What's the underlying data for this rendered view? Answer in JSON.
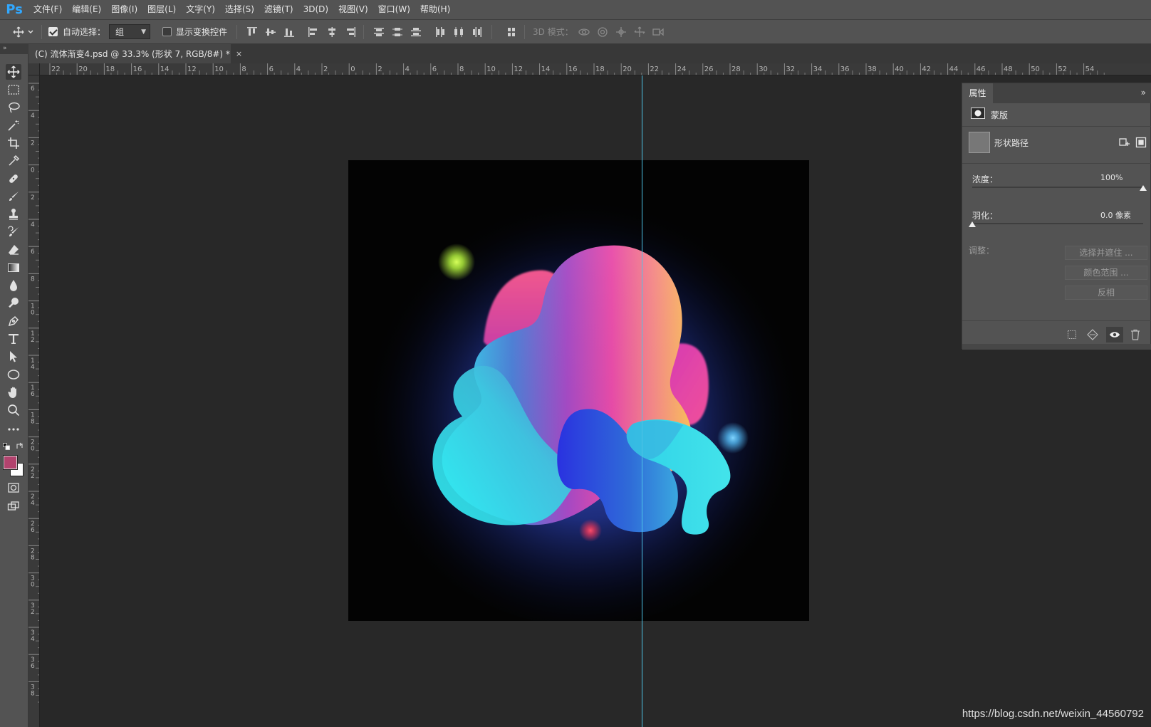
{
  "app": {
    "logo": "Ps"
  },
  "menu": [
    "文件(F)",
    "编辑(E)",
    "图像(I)",
    "图层(L)",
    "文字(Y)",
    "选择(S)",
    "滤镜(T)",
    "3D(D)",
    "视图(V)",
    "窗口(W)",
    "帮助(H)"
  ],
  "options_bar": {
    "auto_select_label": "自动选择：",
    "auto_select_checked": true,
    "auto_select_value": "组",
    "show_transform_label": "显示变换控件",
    "show_transform_checked": false,
    "mode_3d_label": "3D 模式："
  },
  "panel_strip_label": "»",
  "document_tab": {
    "title": "(C) 流体渐变4.psd @ 33.3% (形状 7, RGB/8#) *",
    "close": "×"
  },
  "ruler_top_ticks": [
    "22",
    "20",
    "18",
    "16",
    "14",
    "12",
    "10",
    "8",
    "6",
    "4",
    "2",
    "0",
    "2",
    "4",
    "6",
    "8",
    "10",
    "12",
    "14",
    "16",
    "18",
    "20",
    "22",
    "24",
    "26",
    "28",
    "30",
    "32",
    "34",
    "36",
    "38",
    "40",
    "42",
    "44",
    "46",
    "48",
    "50",
    "52",
    "54"
  ],
  "ruler_left_ticks": [
    "6",
    "4",
    "2",
    "0",
    "2",
    "4",
    "6",
    "8",
    "10",
    "12",
    "14",
    "16",
    "18",
    "20",
    "22",
    "24",
    "26",
    "28",
    "30",
    "32",
    "34",
    "36",
    "38"
  ],
  "properties": {
    "tab": "属性",
    "menu": "»",
    "mask_label": "蒙版",
    "shape_path_label": "形状路径",
    "density_label": "浓度：",
    "density_value": "100%",
    "density_level": 1.0,
    "feather_label": "羽化：",
    "feather_value": "0.0 像素",
    "feather_level": 0.0,
    "adjust_label": "调整：",
    "buttons": [
      "选择并遮住 ...",
      "颜色范围 ...",
      "反相"
    ]
  },
  "colors": {
    "foreground": "#b2436e",
    "background": "#ffffff",
    "guide": "#4ec3e6",
    "accent_logo": "#31a8ff"
  },
  "tools": [
    "move-tool-icon",
    "marquee-tool-icon",
    "lasso-tool-icon",
    "magic-wand-icon",
    "crop-tool-icon",
    "eyedropper-icon",
    "healing-brush-icon",
    "brush-tool-icon",
    "clone-stamp-icon",
    "history-brush-icon",
    "eraser-icon",
    "gradient-tool-icon",
    "blur-tool-icon",
    "dodge-tool-icon",
    "pen-tool-icon",
    "type-tool-icon",
    "path-selection-icon",
    "ellipse-tool-icon",
    "hand-tool-icon",
    "zoom-tool-icon",
    "more-tools-icon"
  ],
  "watermark": "https://blog.csdn.net/weixin_44560792"
}
